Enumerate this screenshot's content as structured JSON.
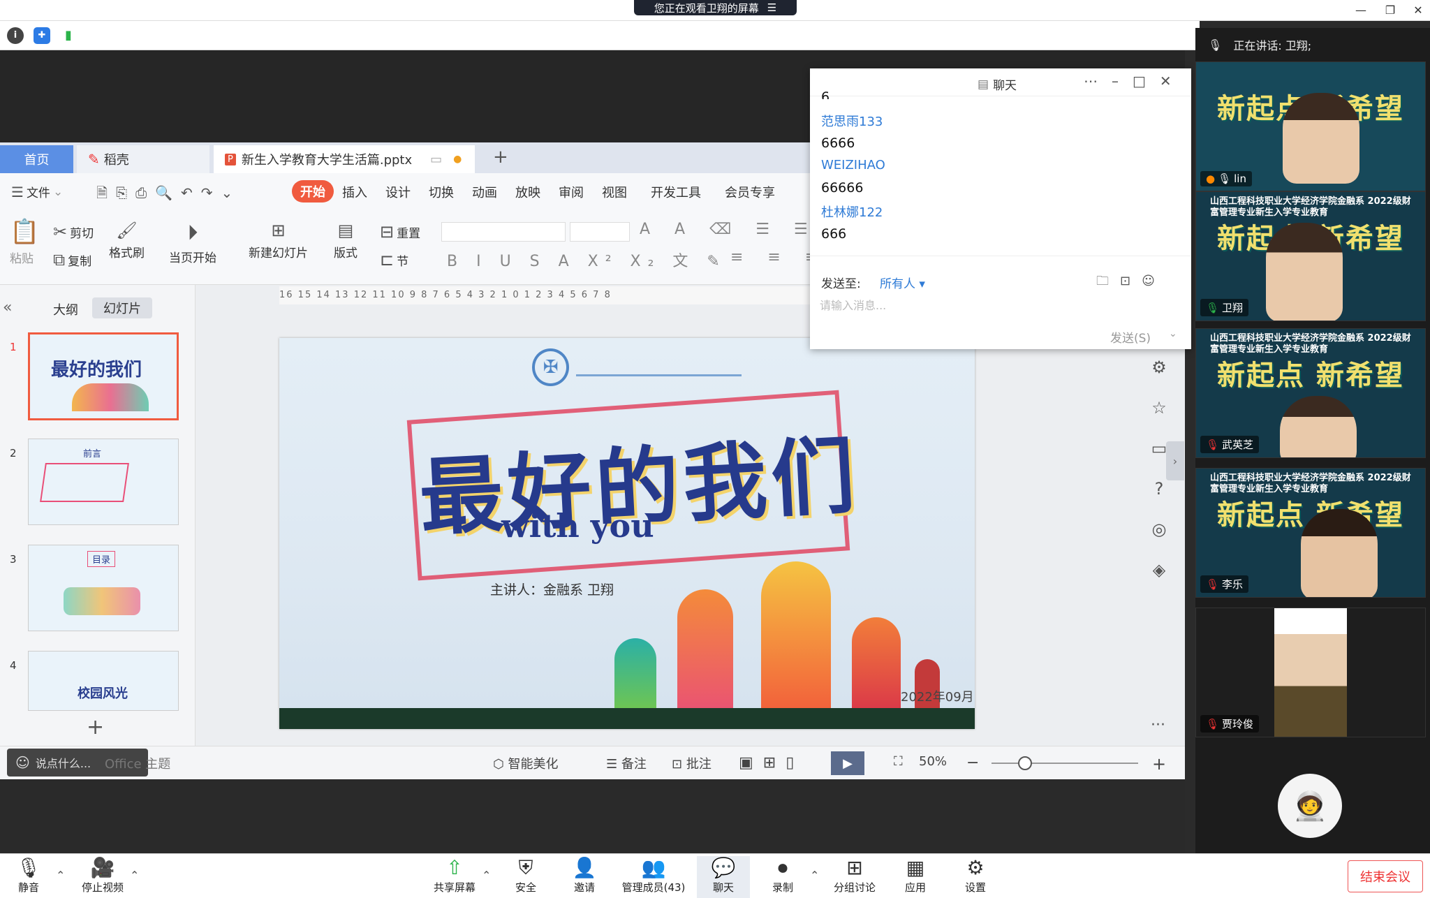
{
  "window": {
    "share_banner": "您正在观看卫翔的屏幕"
  },
  "wps": {
    "tabs": {
      "home": "首页",
      "daoke": "稻壳",
      "doc": "新生入学教育大学生活篇.pptx",
      "add": "+"
    },
    "menu": {
      "file": "文件",
      "start": "开始",
      "insert": "插入",
      "design": "设计",
      "switch": "切换",
      "animation": "动画",
      "show": "放映",
      "review": "审阅",
      "view": "视图",
      "dev": "开发工具",
      "member": "会员专享"
    },
    "tools": {
      "paste": "粘贴",
      "cut": "剪切",
      "copy": "复制",
      "format_brush": "格式刷",
      "play_from_current": "当页开始",
      "new_slide": "新建幻灯片",
      "layout": "版式",
      "section": "节",
      "reset": "重置"
    },
    "pane_tabs": {
      "outline": "大纲",
      "slides": "幻灯片"
    },
    "slide_numbers": [
      "1",
      "2",
      "3",
      "4"
    ],
    "thumbs": {
      "t1": "最好的我们",
      "t2": "前言",
      "t3": "目录",
      "t4": "校园风光"
    },
    "ruler": "16 15 14 13 12 11 10 9 8 7 6 5 4 3 2 1 0 1 2 3 4 5 6 7 8",
    "slide": {
      "title": "最好的我们",
      "subtitle": "with you",
      "presenter": "主讲人：金融系 卫翔",
      "date": "2022年09月"
    },
    "statusbar": {
      "say": "说点什么...",
      "office_theme": "Office 主题",
      "beautify": "智能美化",
      "notes": "备注",
      "annotate": "批注",
      "zoom": "50%"
    }
  },
  "chat": {
    "title": "聊天",
    "messages": [
      {
        "name": "",
        "text": "6"
      },
      {
        "name": "范思雨133",
        "text": "6666"
      },
      {
        "name": "WEIZIHAO",
        "text": "66666"
      },
      {
        "name": "杜林娜122",
        "text": "666"
      }
    ],
    "send_to_label": "发送至:",
    "send_to_value": "所有人",
    "input_placeholder": "请输入消息...",
    "send_button": "发送(S)"
  },
  "gallery": {
    "speaking_label": "正在讲话: 卫翔;",
    "tile_title": "山西工程科技职业大学经济学院金融系\n2022级财富管理专业新生入学专业教育",
    "tile_big": "新起点 新希望",
    "participants": [
      "lin",
      "卫翔",
      "武英芝",
      "李乐",
      "贾玲俊"
    ]
  },
  "bottombar": {
    "mute": "静音",
    "stop_video": "停止视频",
    "share_screen": "共享屏幕",
    "security": "安全",
    "invite": "邀请",
    "manage": "管理成员(43)",
    "chat": "聊天",
    "record": "录制",
    "breakout": "分组讨论",
    "apps": "应用",
    "settings": "设置",
    "end": "结束会议"
  }
}
